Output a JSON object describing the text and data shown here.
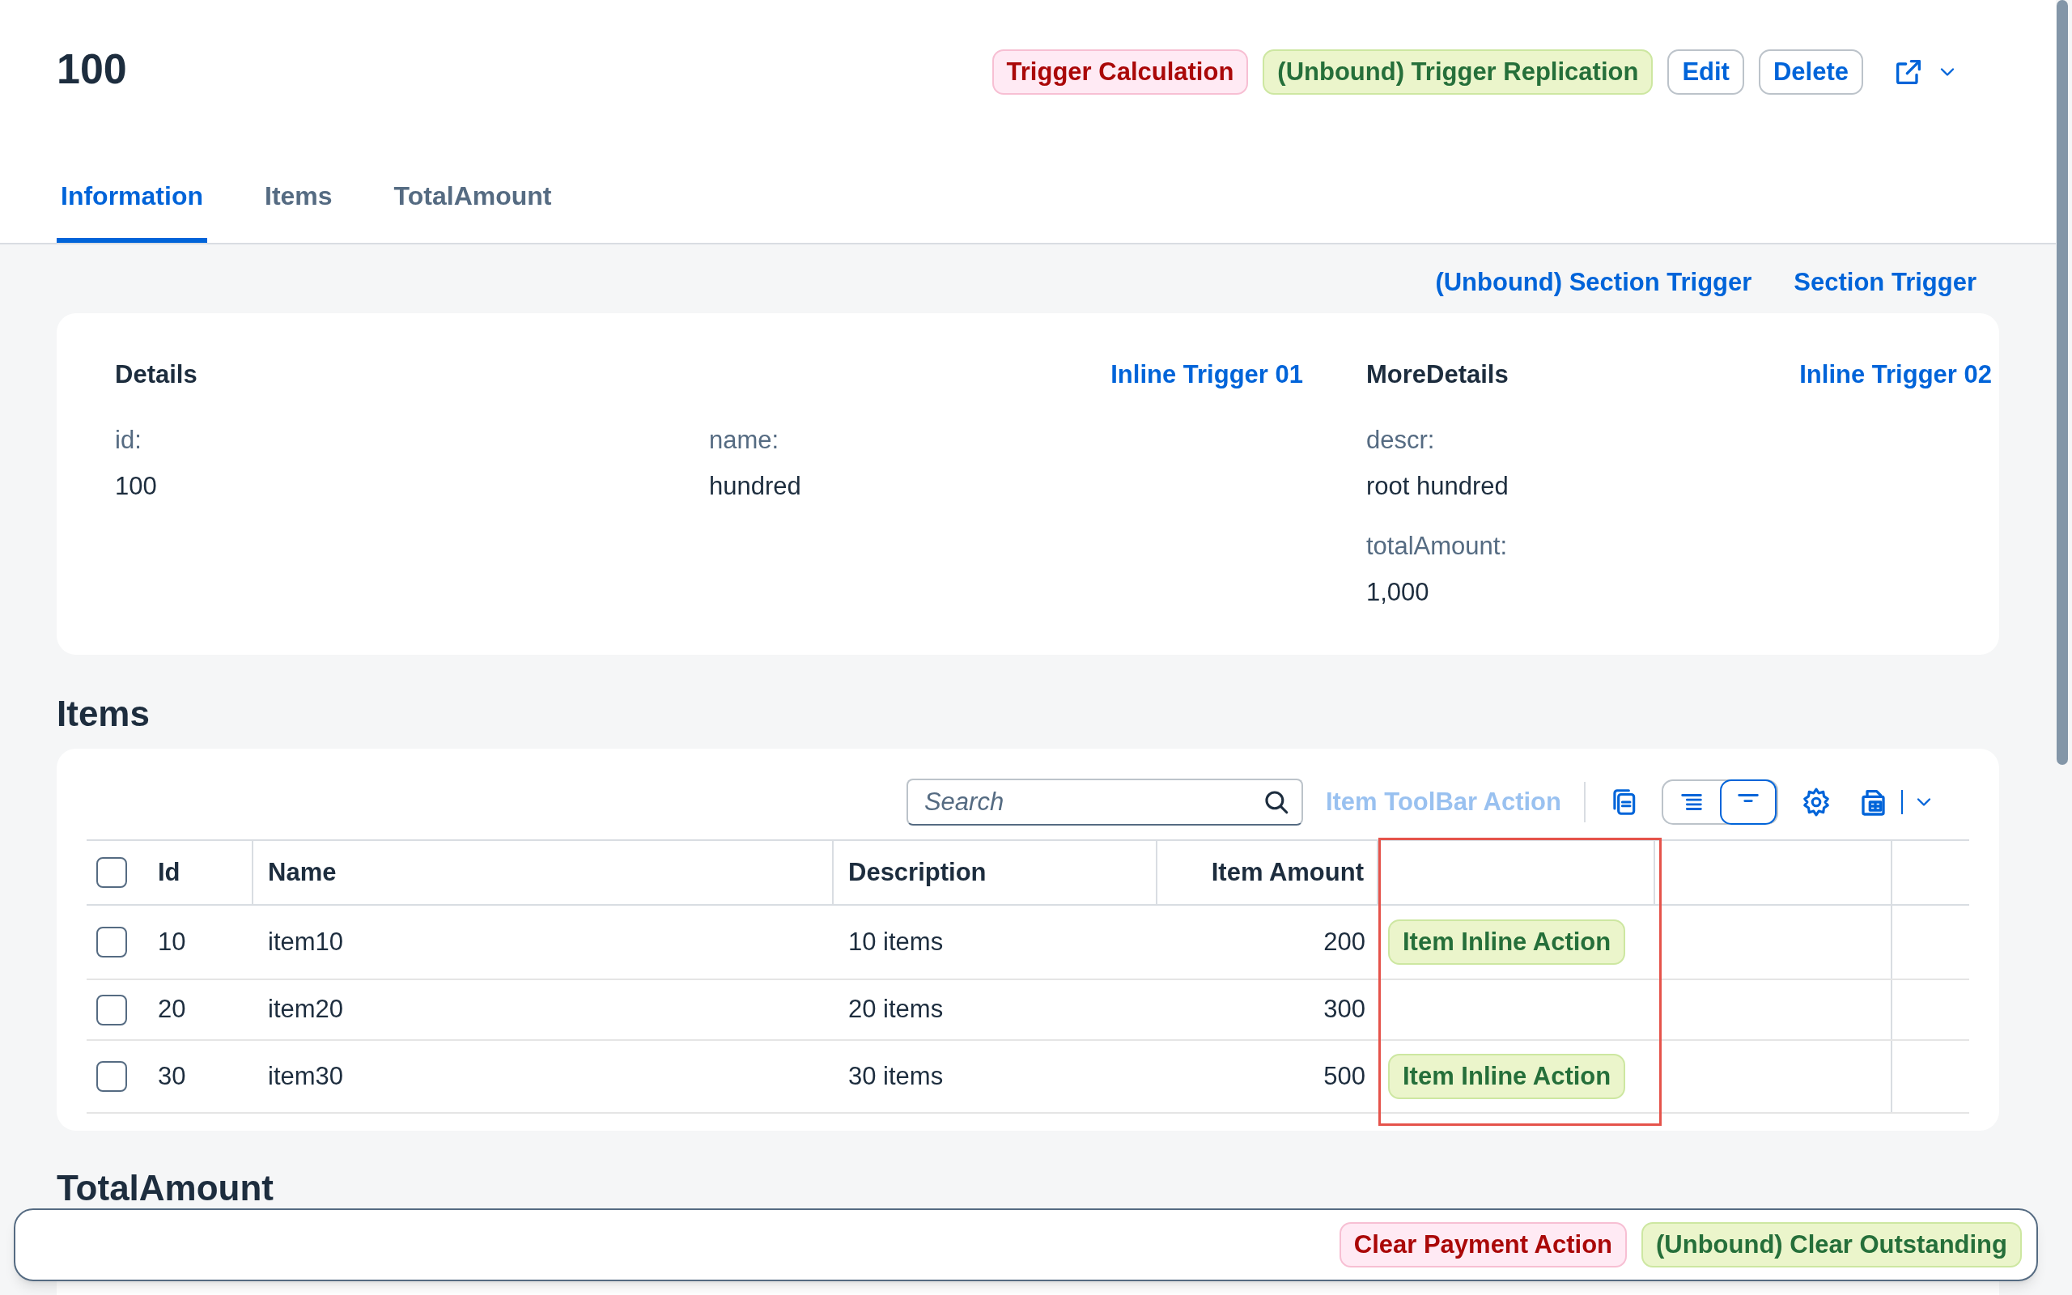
{
  "header": {
    "title": "100",
    "actions": [
      {
        "label": "Trigger Calculation",
        "kind": "negative"
      },
      {
        "label": "(Unbound) Trigger Replication",
        "kind": "positive"
      },
      {
        "label": "Edit",
        "kind": "ghost"
      },
      {
        "label": "Delete",
        "kind": "ghost"
      }
    ]
  },
  "tabs": [
    {
      "label": "Information",
      "selected": true
    },
    {
      "label": "Items",
      "selected": false
    },
    {
      "label": "TotalAmount",
      "selected": false
    }
  ],
  "section_actions": [
    "(Unbound) Section Trigger",
    "Section Trigger"
  ],
  "details": [
    {
      "title": "Details",
      "action": "Inline Trigger 01",
      "columns": [
        [
          {
            "label": "id:",
            "value": "100"
          }
        ],
        [
          {
            "label": "name:",
            "value": "hundred"
          }
        ]
      ]
    },
    {
      "title": "MoreDetails",
      "action": "Inline Trigger 02",
      "columns": [
        [
          {
            "label": "descr:",
            "value": "root hundred"
          },
          {
            "label": "totalAmount:",
            "value": "1,000"
          }
        ]
      ]
    }
  ],
  "items": {
    "title": "Items",
    "search": {
      "placeholder": "Search"
    },
    "toolbar_action": {
      "label": "Item ToolBar Action",
      "disabled": true
    },
    "view_toggle": [
      {
        "selected": false
      },
      {
        "selected": true
      }
    ],
    "columns": [
      "Id",
      "Name",
      "Description",
      "Item Amount"
    ],
    "rows": [
      {
        "selected": false,
        "cells": [
          "10",
          "item10",
          "10 items",
          "200"
        ],
        "action": "Item Inline Action"
      },
      {
        "selected": false,
        "cells": [
          "20",
          "item20",
          "20 items",
          "300"
        ]
      },
      {
        "selected": false,
        "cells": [
          "30",
          "item30",
          "30 items",
          "500"
        ],
        "action": "Item Inline Action"
      }
    ],
    "header_checkbox": {
      "checked": false
    }
  },
  "total_amount": {
    "title": "TotalAmount"
  },
  "footer": {
    "actions": [
      {
        "label": "Clear Payment Action",
        "kind": "negative"
      },
      {
        "label": "(Unbound) Clear Outstanding",
        "kind": "positive"
      }
    ]
  }
}
